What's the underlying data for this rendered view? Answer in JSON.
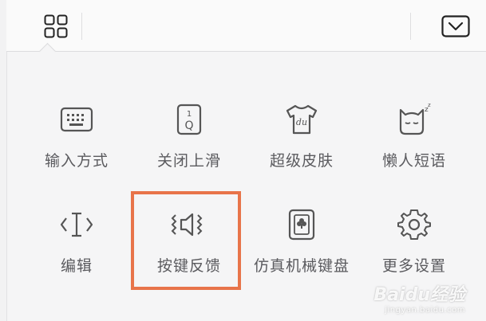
{
  "toolbar": {
    "grid_icon": "grid-icon",
    "collapse_icon": "collapse-icon"
  },
  "menu": {
    "items": [
      {
        "label": "输入方式",
        "icon": "keyboard-icon"
      },
      {
        "label": "关闭上滑",
        "icon": "swipe-up-key-icon"
      },
      {
        "label": "超级皮肤",
        "icon": "tshirt-skin-icon"
      },
      {
        "label": "懒人短语",
        "icon": "sleepy-cat-icon"
      },
      {
        "label": "编辑",
        "icon": "text-cursor-icon"
      },
      {
        "label": "按键反馈",
        "icon": "vibrate-sound-icon"
      },
      {
        "label": "仿真机械键盘",
        "icon": "mechanical-key-icon"
      },
      {
        "label": "更多设置",
        "icon": "gear-icon"
      }
    ],
    "highlighted": "按键反馈"
  },
  "watermark": {
    "brand": "Baidu经验",
    "url": "jingyan.baidu.com"
  },
  "colors": {
    "highlight": "#e8744a",
    "icon": "#555555",
    "background": "#f5f5f6"
  }
}
